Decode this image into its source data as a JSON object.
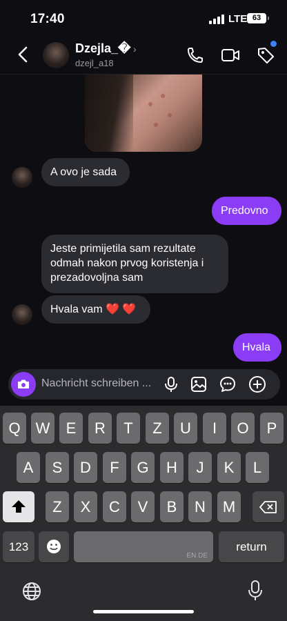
{
  "status": {
    "time": "17:40",
    "network": "LTE",
    "battery": "63"
  },
  "contact": {
    "name": "Dzejla_�",
    "handle": "dzejl_a18"
  },
  "messages": [
    {
      "side": "in",
      "text": "A ovo je sada"
    },
    {
      "side": "out",
      "text": "Predovno"
    },
    {
      "side": "in",
      "text": "Jeste primijetila sam rezultate odmah nakon prvog koristenja i prezadovoljna sam"
    },
    {
      "side": "in",
      "text": "Hvala vam ❤️ ❤️"
    },
    {
      "side": "out",
      "text": "Hvala"
    }
  ],
  "composer": {
    "placeholder": "Nachricht schreiben ..."
  },
  "keyboard": {
    "row1": [
      "Q",
      "W",
      "E",
      "R",
      "T",
      "Z",
      "U",
      "I",
      "O",
      "P"
    ],
    "row2": [
      "A",
      "S",
      "D",
      "F",
      "G",
      "H",
      "J",
      "K",
      "L"
    ],
    "row3": [
      "Z",
      "X",
      "C",
      "V",
      "B",
      "N",
      "M"
    ],
    "numbers": "123",
    "return": "return",
    "space_langs": "EN DE"
  },
  "colors": {
    "accent": "#8b3cf5",
    "incoming": "#2b2b32",
    "background": "#0d0d12",
    "dot": "#3b82f6"
  },
  "icons": [
    "back-icon",
    "chevron-right-icon",
    "phone-icon",
    "video-icon",
    "tag-icon",
    "camera-icon",
    "mic-icon",
    "image-icon",
    "sticker-icon",
    "plus-icon",
    "shift-icon",
    "backspace-icon",
    "emoji-icon",
    "globe-icon",
    "dictation-icon"
  ]
}
